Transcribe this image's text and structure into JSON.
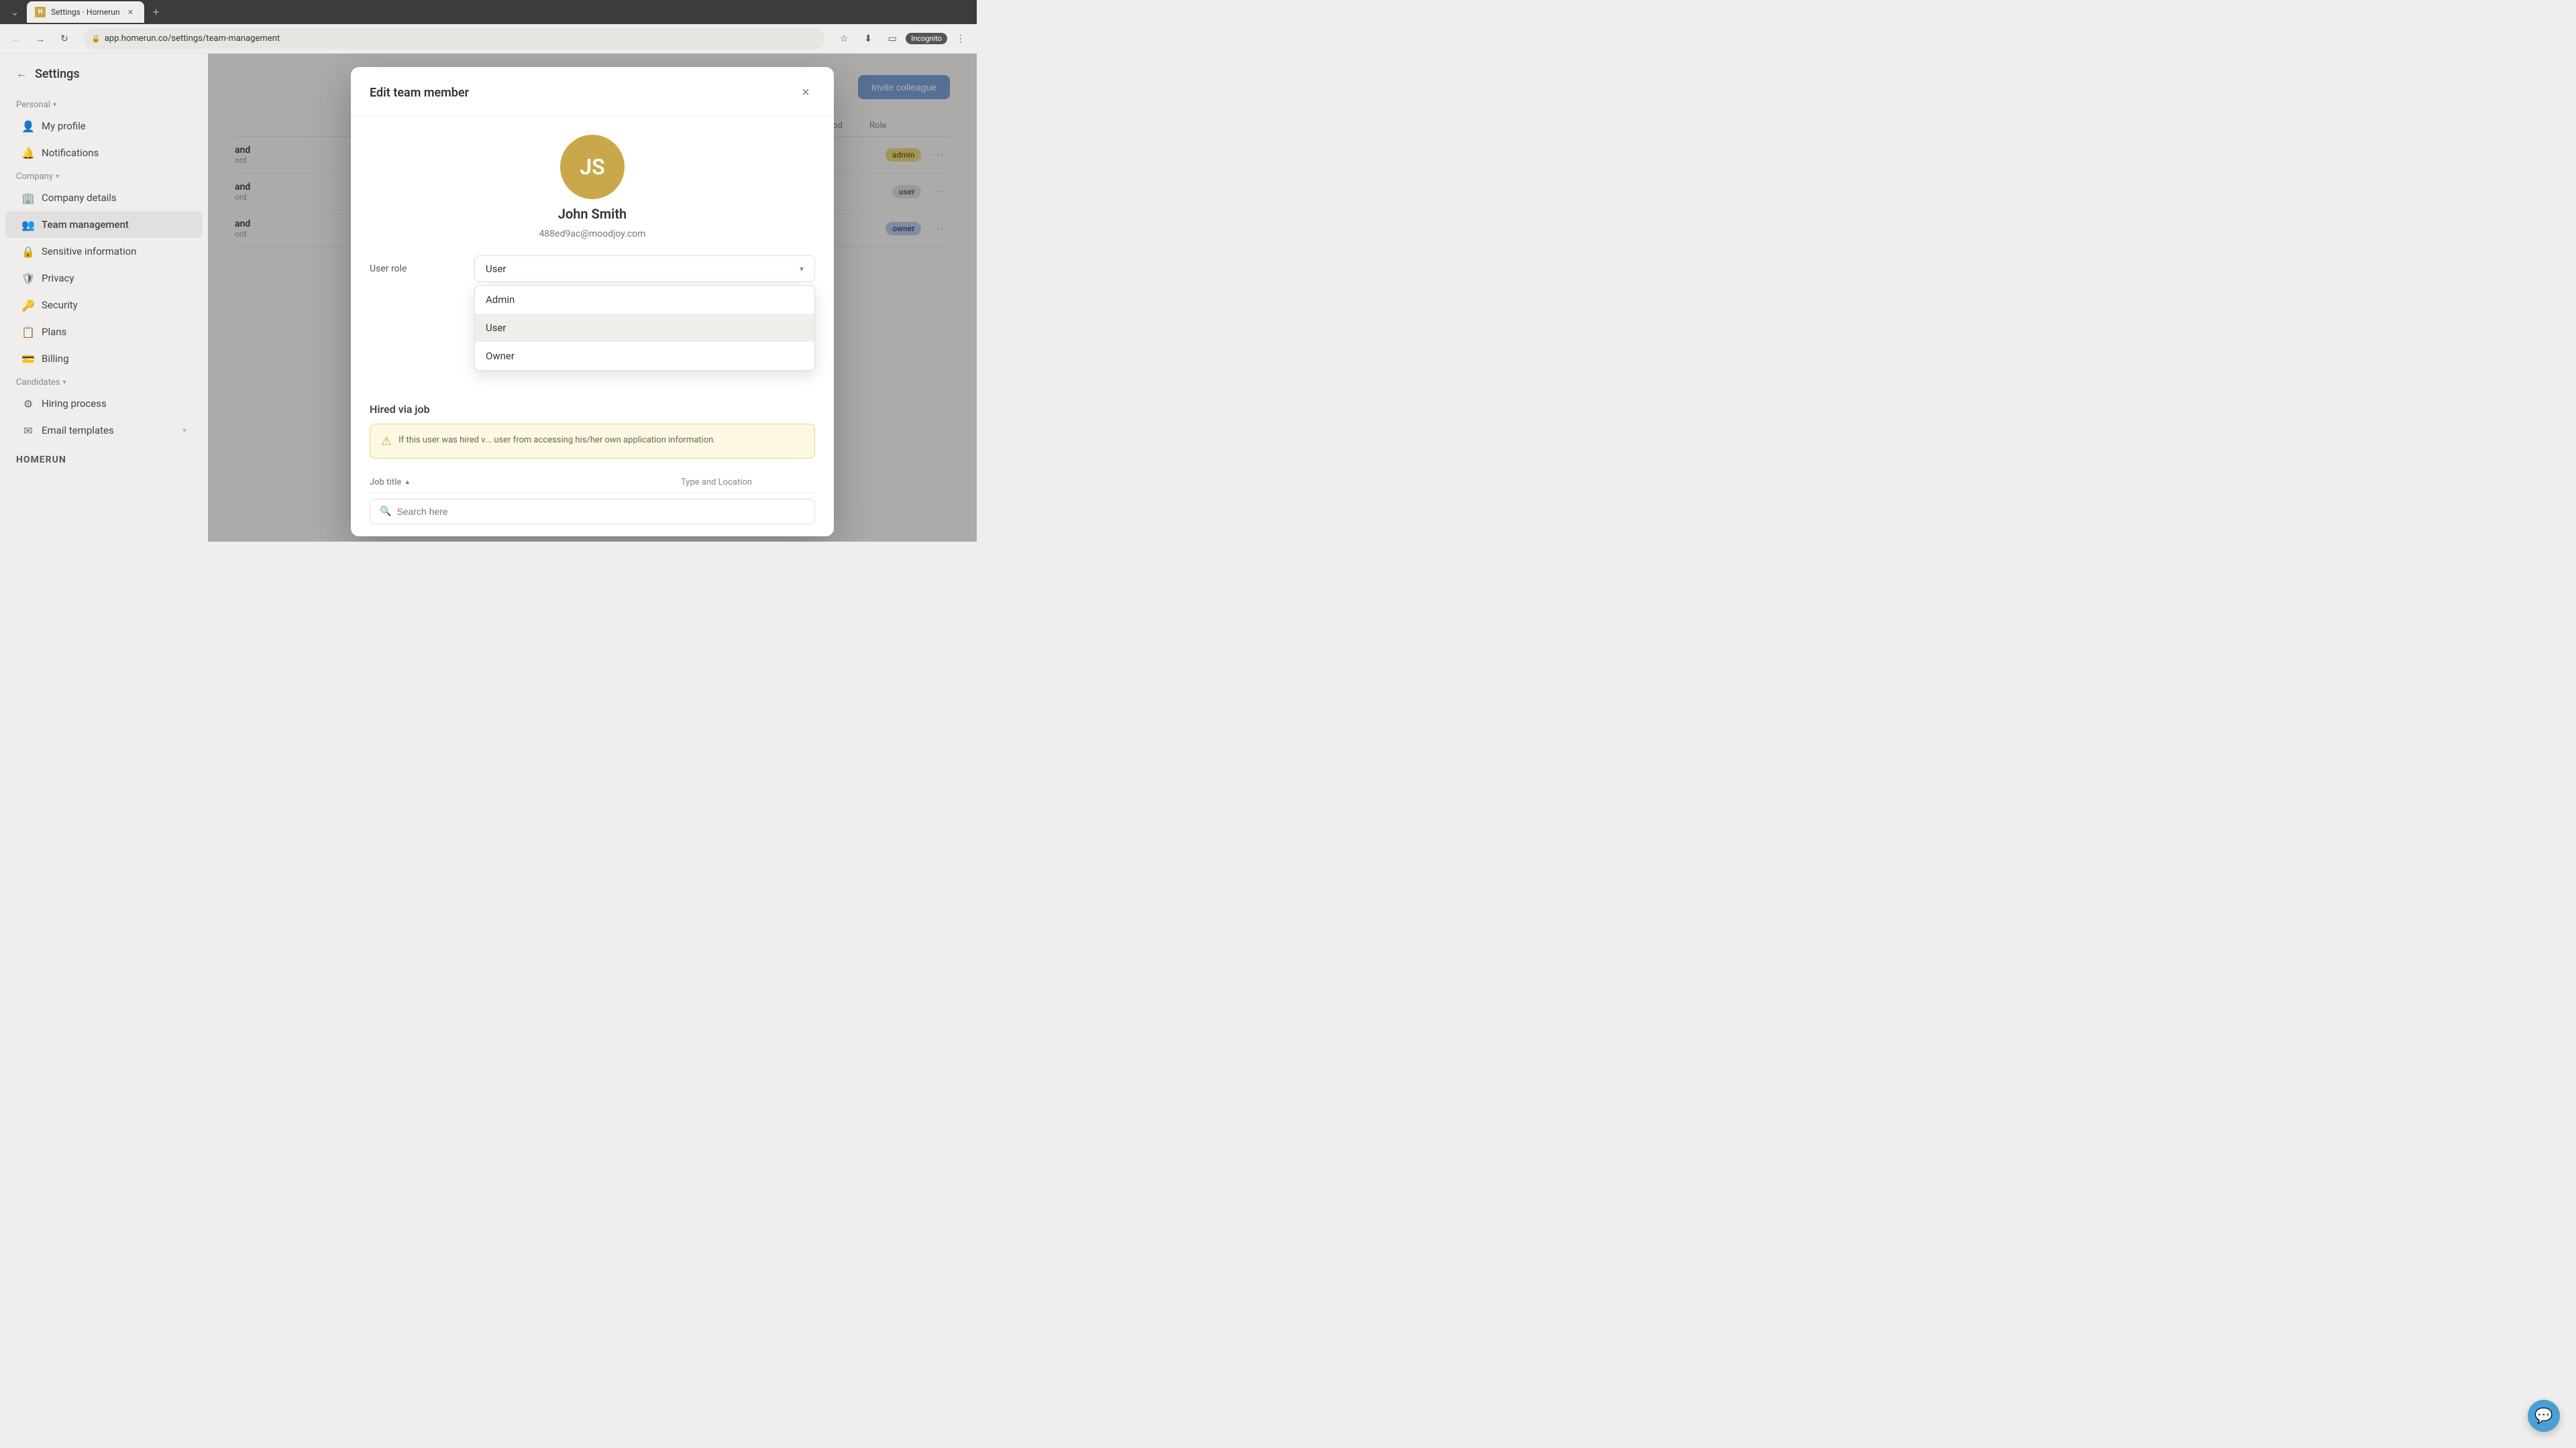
{
  "browser": {
    "tab_label": "Settings · Homerun",
    "tab_favicon_text": "H",
    "address": "app.homerun.co/settings/team-management",
    "incognito_label": "Incognito"
  },
  "sidebar": {
    "back_label": "←",
    "title": "Settings",
    "personal_section": "Personal",
    "my_profile_label": "My profile",
    "notifications_label": "Notifications",
    "company_section": "Company",
    "company_details_label": "Company details",
    "team_management_label": "Team management",
    "sensitive_info_label": "Sensitive information",
    "privacy_label": "Privacy",
    "security_label": "Security",
    "plans_label": "Plans",
    "billing_label": "Billing",
    "candidates_section": "Candidates",
    "hiring_process_label": "Hiring process",
    "email_templates_label": "Email templates",
    "logo_text": "HOMERUN"
  },
  "main": {
    "invite_btn_label": "Invite colleague",
    "col_method": "method",
    "col_role": "Role",
    "rows": [
      {
        "name": "and",
        "detail": "ord",
        "role": "admin"
      },
      {
        "name": "and",
        "detail": "ord",
        "role": "user"
      },
      {
        "name": "and",
        "detail": "ord",
        "role": "owner"
      }
    ]
  },
  "modal": {
    "title": "Edit team member",
    "close_btn_label": "×",
    "avatar_initials": "JS",
    "user_fullname": "John Smith",
    "user_email": "488ed9ac@moodjoy.com",
    "role_label": "User role",
    "current_role": "User",
    "dropdown_options": [
      {
        "value": "Admin",
        "label": "Admin"
      },
      {
        "value": "User",
        "label": "User",
        "selected": true
      },
      {
        "value": "Owner",
        "label": "Owner"
      }
    ],
    "hired_via_label": "Hired via job",
    "warning_text": "If this user was hired v... user from accessing his/her own application information.",
    "job_title_col": "Job title",
    "type_location_col": "Type and Location",
    "search_placeholder": "Search here"
  },
  "chat_btn_label": "💬"
}
